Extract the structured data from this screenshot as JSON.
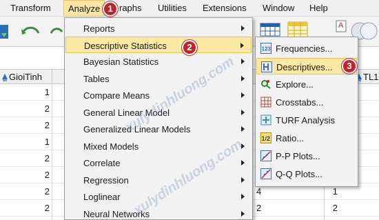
{
  "menubar": {
    "items": [
      {
        "label": "Transform"
      },
      {
        "label": "Analyze"
      },
      {
        "label": "raphs"
      },
      {
        "label": "Utilities"
      },
      {
        "label": "Extensions"
      },
      {
        "label": "Window"
      },
      {
        "label": "Help"
      }
    ]
  },
  "grid": {
    "columns": [
      {
        "label": "GioiTinh"
      },
      {
        "label": "TL1"
      }
    ],
    "left_values": [
      "1",
      "2",
      "2",
      "1",
      "2",
      "2",
      "2",
      "2"
    ],
    "right_values": [
      {
        "a": "",
        "b": ""
      },
      {
        "a": "",
        "b": ""
      },
      {
        "a": "",
        "b": ""
      },
      {
        "a": "",
        "b": ""
      },
      {
        "a": "",
        "b": ""
      },
      {
        "a": "",
        "b": ""
      },
      {
        "a": "4",
        "b": "1"
      },
      {
        "a": "2",
        "b": "2"
      }
    ]
  },
  "analyze_menu": {
    "items": [
      {
        "label": "Reports",
        "submenu": true
      },
      {
        "label": "Descriptive Statistics",
        "submenu": true
      },
      {
        "label": "Bayesian Statistics",
        "submenu": true
      },
      {
        "label": "Tables",
        "submenu": true
      },
      {
        "label": "Compare Means",
        "submenu": true
      },
      {
        "label": "General Linear Model",
        "submenu": true
      },
      {
        "label": "Generalized Linear Models",
        "submenu": true
      },
      {
        "label": "Mixed Models",
        "submenu": true
      },
      {
        "label": "Correlate",
        "submenu": true
      },
      {
        "label": "Regression",
        "submenu": true
      },
      {
        "label": "Loglinear",
        "submenu": true
      },
      {
        "label": "Neural Networks",
        "submenu": true
      }
    ]
  },
  "descriptive_submenu": {
    "items": [
      {
        "label": "Frequencies...",
        "icon": "frequencies-icon"
      },
      {
        "label": "Descriptives...",
        "icon": "descriptives-icon"
      },
      {
        "label": "Explore...",
        "icon": "explore-icon"
      },
      {
        "label": "Crosstabs...",
        "icon": "crosstabs-icon"
      },
      {
        "label": "TURF Analysis",
        "icon": "turf-icon"
      },
      {
        "label": "Ratio...",
        "icon": "ratio-icon"
      },
      {
        "label": "P-P Plots...",
        "icon": "pp-plot-icon"
      },
      {
        "label": "Q-Q Plots...",
        "icon": "qq-plot-icon"
      }
    ]
  },
  "badges": [
    "1",
    "2",
    "3"
  ],
  "watermark": "xulydinhluong.com",
  "colors": {
    "highlight": "#fde9a4",
    "badge": "#c0242a",
    "menu_bg": "#f2f2f2"
  }
}
